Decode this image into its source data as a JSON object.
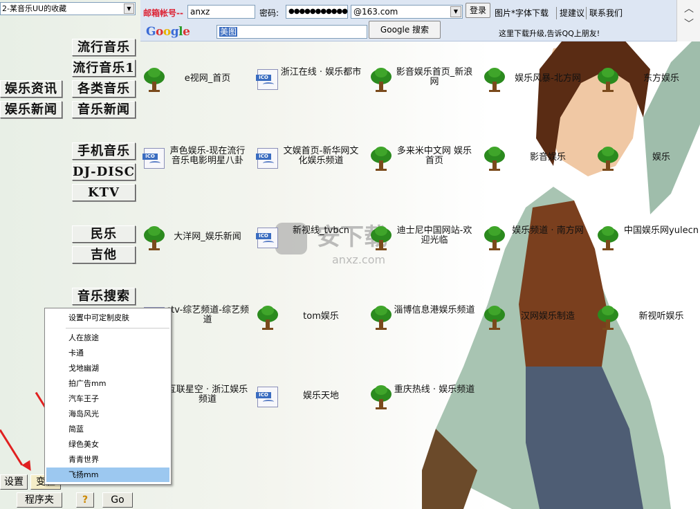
{
  "favorites": {
    "selected": "2-某音乐UU的收藏"
  },
  "nav": {
    "right_col": [
      "流行音乐",
      "流行音乐1",
      "各类音乐",
      "音乐新闻",
      "手机音乐",
      "DJ-DISCO",
      "KTV",
      "民乐",
      "吉他",
      "音乐搜索"
    ],
    "left_col": [
      "娱乐资讯",
      "娱乐新闻"
    ]
  },
  "topbar": {
    "email_label": "邮箱帐号--",
    "email_value": "anxz",
    "password_label": "密码:",
    "password_value": "●●●●●●●●●●●",
    "domain_value": "@163.com",
    "login_label": "登录",
    "links": [
      "图片*字体下载",
      "提建议",
      "联系我们"
    ],
    "google_logo": "Google",
    "search_value": "美图",
    "search_button": "Google 搜索",
    "notice": "这里下载升级,告诉QQ上朋友!"
  },
  "grid": [
    [
      {
        "icon": "tree",
        "label": "e视网_首页"
      },
      {
        "icon": "ico",
        "label": "浙江在线 · 娱乐都市"
      },
      {
        "icon": "tree",
        "label": "影音娱乐首页_新浪网"
      },
      {
        "icon": "tree",
        "label": "娱乐风暴-北方网"
      },
      {
        "icon": "tree",
        "label": "东方娱乐"
      }
    ],
    [
      {
        "icon": "ico",
        "label": "声色娱乐-现在流行音乐电影明星八卦"
      },
      {
        "icon": "ico",
        "label": "文娱首页-新华网文化娱乐频道"
      },
      {
        "icon": "tree",
        "label": "多来米中文网 娱乐 首页"
      },
      {
        "icon": "tree",
        "label": "影音娱乐"
      },
      {
        "icon": "tree",
        "label": "娱乐"
      }
    ],
    [
      {
        "icon": "tree",
        "label": "大洋网_娱乐新闻"
      },
      {
        "icon": "ico",
        "label": "新视线_tvbcn"
      },
      {
        "icon": "tree",
        "label": "迪士尼中国网站-欢迎光临"
      },
      {
        "icon": "tree",
        "label": "娱乐频道 · 南方网"
      },
      {
        "icon": "tree",
        "label": "中国娱乐网yulecn"
      }
    ],
    [
      {
        "icon": "ico",
        "label": "ctv-综艺频道-综艺频道"
      },
      {
        "icon": "tree",
        "label": "tom娱乐"
      },
      {
        "icon": "tree",
        "label": "淄博信息港娱乐频道"
      },
      {
        "icon": "tree",
        "label": "汉网娱乐制造"
      },
      {
        "icon": "tree",
        "label": "新视听娱乐"
      }
    ],
    [
      {
        "icon": "ico",
        "label": "互联星空 · 浙江娱乐频道"
      },
      {
        "icon": "ico",
        "label": "娱乐天地"
      },
      {
        "icon": "tree",
        "label": "重庆热线 · 娱乐频道"
      }
    ]
  ],
  "popup": {
    "header": "设置中可定制皮肤",
    "items": [
      "人在旅途",
      "卡通",
      "戈地幽湖",
      "拍广告mm",
      "汽车王子",
      "海岛风光",
      "简蓝",
      "绿色美女",
      "青青世界",
      "飞扬mm"
    ],
    "selected": "飞扬mm"
  },
  "bottom": {
    "settings": "设置",
    "skin": "变脸",
    "folder": "程序夹",
    "go": "Go",
    "help": "?"
  },
  "watermark": {
    "text": "安下载",
    "url": "anxz.com"
  },
  "colors": {
    "accent": "#3a6cc0",
    "tree": "#2b8a1e",
    "arrow": "#e02020",
    "selected": "#9cc8f0"
  }
}
